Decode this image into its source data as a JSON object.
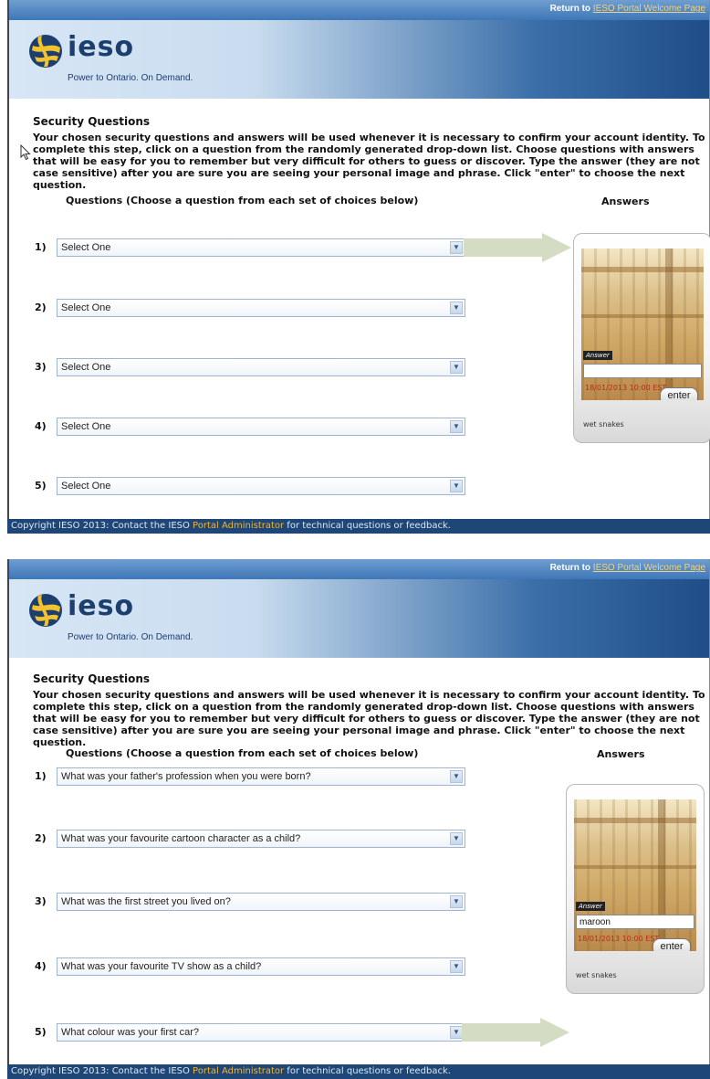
{
  "panels": [
    {
      "topbar": {
        "prefix": "Return to ",
        "link": "IESO Portal Welcome Page"
      },
      "logo": {
        "text": "ieso",
        "tagline": "Power to Ontario. On Demand."
      },
      "section_title": "Security Questions",
      "intro": "Your chosen security questions and answers will be used whenever it is necessary to confirm your account identity. To complete this step, click on a question from the randomly generated drop-down list. Choose questions with answers that will be easy for you to remember but very difficult for others to guess or discover. Type the answer (they are not case sensitive) after you are sure you are seeing your personal image and phrase. Click \"enter\" to choose the next question.",
      "questions_header": "Questions (Choose a question from each set of choices below)",
      "answers_header": "Answers",
      "questions": [
        {
          "num": "1)",
          "value": "Select One"
        },
        {
          "num": "2)",
          "value": "Select One"
        },
        {
          "num": "3)",
          "value": "Select One"
        },
        {
          "num": "4)",
          "value": "Select One"
        },
        {
          "num": "5)",
          "value": "Select One"
        }
      ],
      "answer_box": {
        "tag": "Answer",
        "value": "",
        "timestamp": "18/01/2013 10:00 EST",
        "enter": "enter",
        "phrase": "wet snakes"
      },
      "footer": {
        "prefix": "Copyright IESO 2013: Contact the IESO ",
        "admin": "Portal Administrator",
        "suffix": " for technical questions or feedback."
      }
    },
    {
      "topbar": {
        "prefix": "Return to ",
        "link": "IESO Portal Welcome Page"
      },
      "logo": {
        "text": "ieso",
        "tagline": "Power to Ontario. On Demand."
      },
      "section_title": "Security Questions",
      "intro": "Your chosen security questions and answers will be used whenever it is necessary to confirm your account identity. To complete this step, click on a question from the randomly generated drop-down list. Choose questions with answers that will be easy for you to remember but very difficult for others to guess or discover. Type the answer (they are not case sensitive) after you are sure you are seeing your personal image and phrase. Click \"enter\" to choose the next question.",
      "questions_header": "Questions (Choose a question from each set of choices below)",
      "answers_header": "Answers",
      "questions": [
        {
          "num": "1)",
          "value": "What was your father's profession when you were born?"
        },
        {
          "num": "2)",
          "value": "What was your favourite cartoon character as a child?"
        },
        {
          "num": "3)",
          "value": "What was the first street you lived on?"
        },
        {
          "num": "4)",
          "value": "What was your favourite TV show as a child?"
        },
        {
          "num": "5)",
          "value": "What colour was your first car?"
        }
      ],
      "answer_box": {
        "tag": "Answer",
        "value": "maroon",
        "timestamp": "18/01/2013 10:00 EST",
        "enter": "enter",
        "phrase": "wet snakes"
      },
      "footer": {
        "prefix": "Copyright IESO 2013: Contact the IESO ",
        "admin": "Portal Administrator",
        "suffix": " for technical questions or feedback."
      }
    }
  ],
  "icons": {
    "logo": "ieso-globe-icon",
    "chevron": "chevron-down-icon",
    "pointer": "mouse-cursor-icon",
    "arrow": "active-question-arrow-icon"
  },
  "colors": {
    "brand_blue": "#1d3f6e",
    "footer_blue": "#1e4778",
    "link_gold": "#f3d27a",
    "admin_orange": "#f3b431",
    "arrow_fill": "#d5dcc4"
  }
}
